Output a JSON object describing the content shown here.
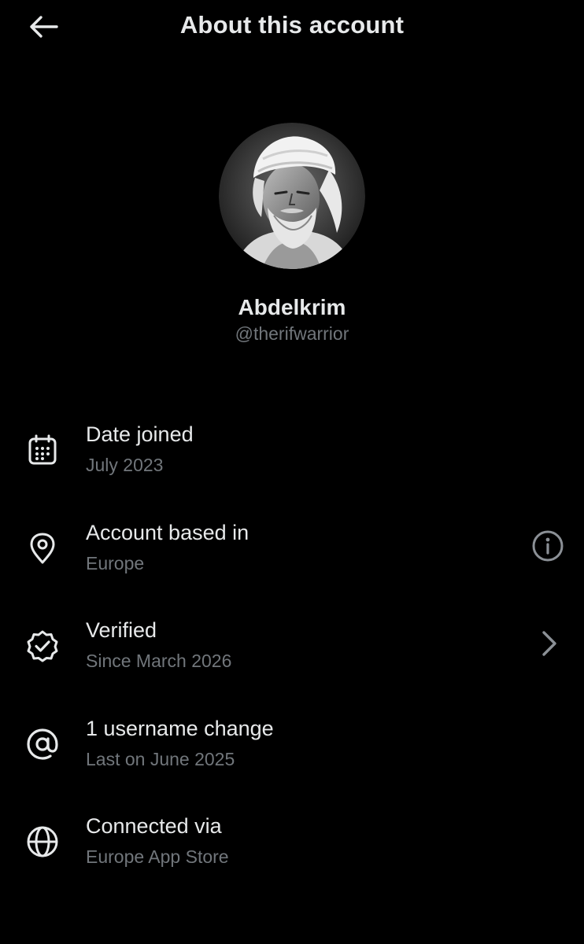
{
  "header": {
    "title": "About this account",
    "back_icon": "arrow-left-icon"
  },
  "profile": {
    "display_name": "Abdelkrim",
    "handle": "@therifwarrior",
    "avatar": "grayscale portrait photo of an elderly bearded man wearing a white turban"
  },
  "rows": [
    {
      "title": "Date joined",
      "subtitle": "July 2023",
      "icon": "calendar-icon"
    },
    {
      "title": "Account based in",
      "subtitle": "Europe",
      "icon": "location-pin-icon",
      "action_icon": "info-icon"
    },
    {
      "title": "Verified",
      "subtitle": "Since March 2026",
      "icon": "verified-badge-icon",
      "action_icon": "chevron-right-icon"
    },
    {
      "title": "1 username change",
      "subtitle": "Last on June 2025",
      "icon": "at-sign-icon"
    },
    {
      "title": "Connected via",
      "subtitle": "Europe App Store",
      "icon": "globe-icon"
    }
  ],
  "colors": {
    "background": "#000000",
    "primary_text": "#e7e9ea",
    "secondary_text": "#71767b"
  }
}
